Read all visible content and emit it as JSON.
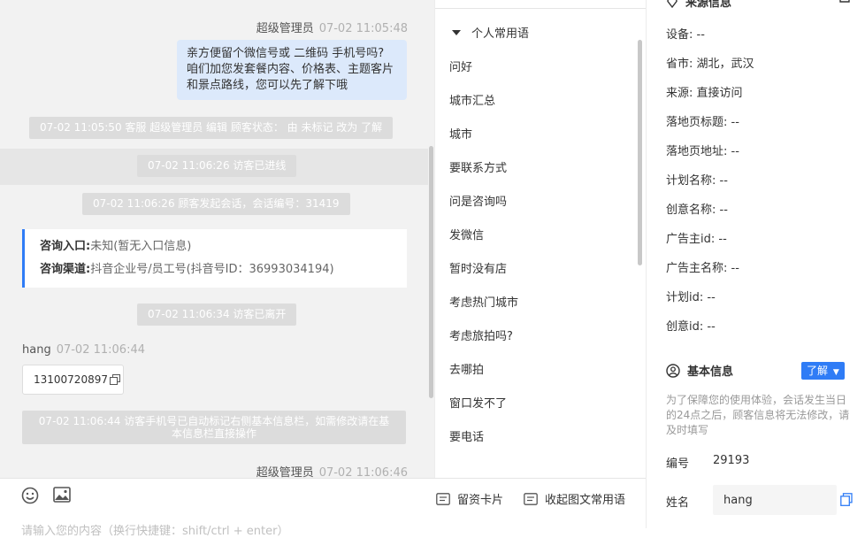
{
  "chat": {
    "messages": {
      "m1_sender": "超级管理员",
      "m1_time": "07-02 11:05:48",
      "m1_line1": "亲方便留个微信号或 二维码 手机号吗?",
      "m1_line2": "咱们加您发套餐内容、价格表、主题客片",
      "m1_line3": "和景点路线，您可以先了解下哦",
      "sys1": "07-02 11:05:50 客服 超级管理员 编辑 顾客状态： 由 未标记 改为 了解",
      "sys2": "07-02 11:06:26 访客已进线",
      "sys3": "07-02 11:06:26 顾客发起会话，会话编号：31419",
      "card_entry_label": "咨询入口:",
      "card_entry_value": "未知(暂无入口信息)",
      "card_channel_label": "咨询渠道:",
      "card_channel_value": "抖音企业号/员工号(抖音号ID：36993034194)",
      "sys4": "07-02 11:06:34 访客已离开",
      "m2_sender": "hang",
      "m2_time": "07-02 11:06:44",
      "m2_phone": "13100720897",
      "sys5_line1": "07-02 11:06:44 访客手机号已自动标记右侧基本信息栏，如需修改请在基",
      "sys5_line2": "本信息栏直接操作",
      "m3_sender": "超级管理员",
      "m3_time": "07-02 11:06:46"
    }
  },
  "composer": {
    "card_btn": "留资卡片",
    "phrase_btn": "收起图文常用语",
    "placeholder": "请输入您的内容（换行快捷键：shift/ctrl + enter）"
  },
  "phrases": {
    "group_title": "个人常用语",
    "items": [
      "问好",
      "城市汇总",
      "城市",
      "要联系方式",
      "问是咨询吗",
      "发微信",
      "暂时没有店",
      "考虑热门城市",
      "考虑旅拍吗?",
      "去哪拍",
      "窗口发不了",
      "要电话"
    ]
  },
  "info": {
    "source_title": "来源信息",
    "source_fields": [
      "设备: --",
      "省市: 湖北，武汉",
      "来源: 直接访问",
      "落地页标题: --",
      "落地页地址: --",
      "计划名称: --",
      "创意名称: --",
      "广告主id: --",
      "广告主名称: --",
      "计划id: --",
      "创意id: --"
    ],
    "basic_title": "基本信息",
    "learn_btn": "了解",
    "notice": "为了保障您的使用体验，会话发生当日的24点之后，顾客信息将无法修改，请及时填写",
    "id_label": "编号",
    "id_value": "29193",
    "name_label": "姓名",
    "name_value": "hang"
  },
  "colors": {
    "accent": "#2f7cf6",
    "bubble": "#dce9fb",
    "sys_bg": "#dcdcdc"
  }
}
